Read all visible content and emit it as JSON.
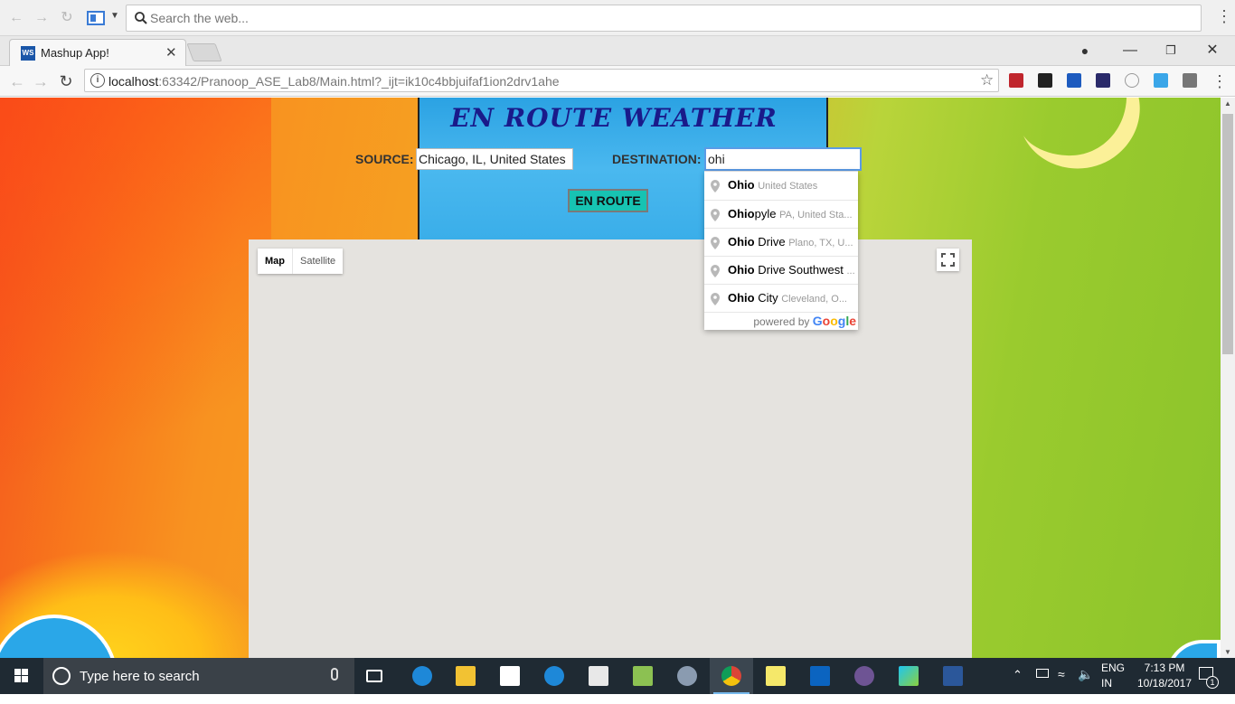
{
  "topbar": {
    "search_placeholder": "Search the web..."
  },
  "browser": {
    "tab_title": "Mashup App!",
    "tab_favicon": "WS",
    "url_host": "localhost",
    "url_rest": ":63342/Pranoop_ASE_Lab8/Main.html?_ijt=ik10c4bbjuifaf1ion2drv1ahe"
  },
  "app": {
    "title": "EN ROUTE WEATHER",
    "source_label": "SOURCE:",
    "source_value": "Chicago, IL, United States",
    "destination_label": "DESTINATION:",
    "destination_value": "ohi",
    "button_label": "EN ROUTE"
  },
  "map": {
    "type_map": "Map",
    "type_satellite": "Satellite"
  },
  "autocomplete": {
    "items": [
      {
        "match": "Ohio",
        "rest": "",
        "secondary": "United States"
      },
      {
        "match": "Ohio",
        "rest": "pyle",
        "secondary": "PA, United Sta..."
      },
      {
        "match": "Ohio",
        "rest": " Drive",
        "secondary": "Plano, TX, U..."
      },
      {
        "match": "Ohio",
        "rest": " Drive Southwest",
        "secondary": "..."
      },
      {
        "match": "Ohio",
        "rest": " City",
        "secondary": "Cleveland, O..."
      }
    ],
    "powered_by": "powered by",
    "brand": "Google"
  },
  "taskbar": {
    "search_placeholder": "Type here to search",
    "lang_line1": "ENG",
    "lang_line2": "IN",
    "time": "7:13 PM",
    "date": "10/18/2017",
    "notifications": "1"
  },
  "colors": {
    "accent_button": "#17c3b2",
    "title_color": "#1a1a8a",
    "taskbar": "#1f2a33"
  }
}
